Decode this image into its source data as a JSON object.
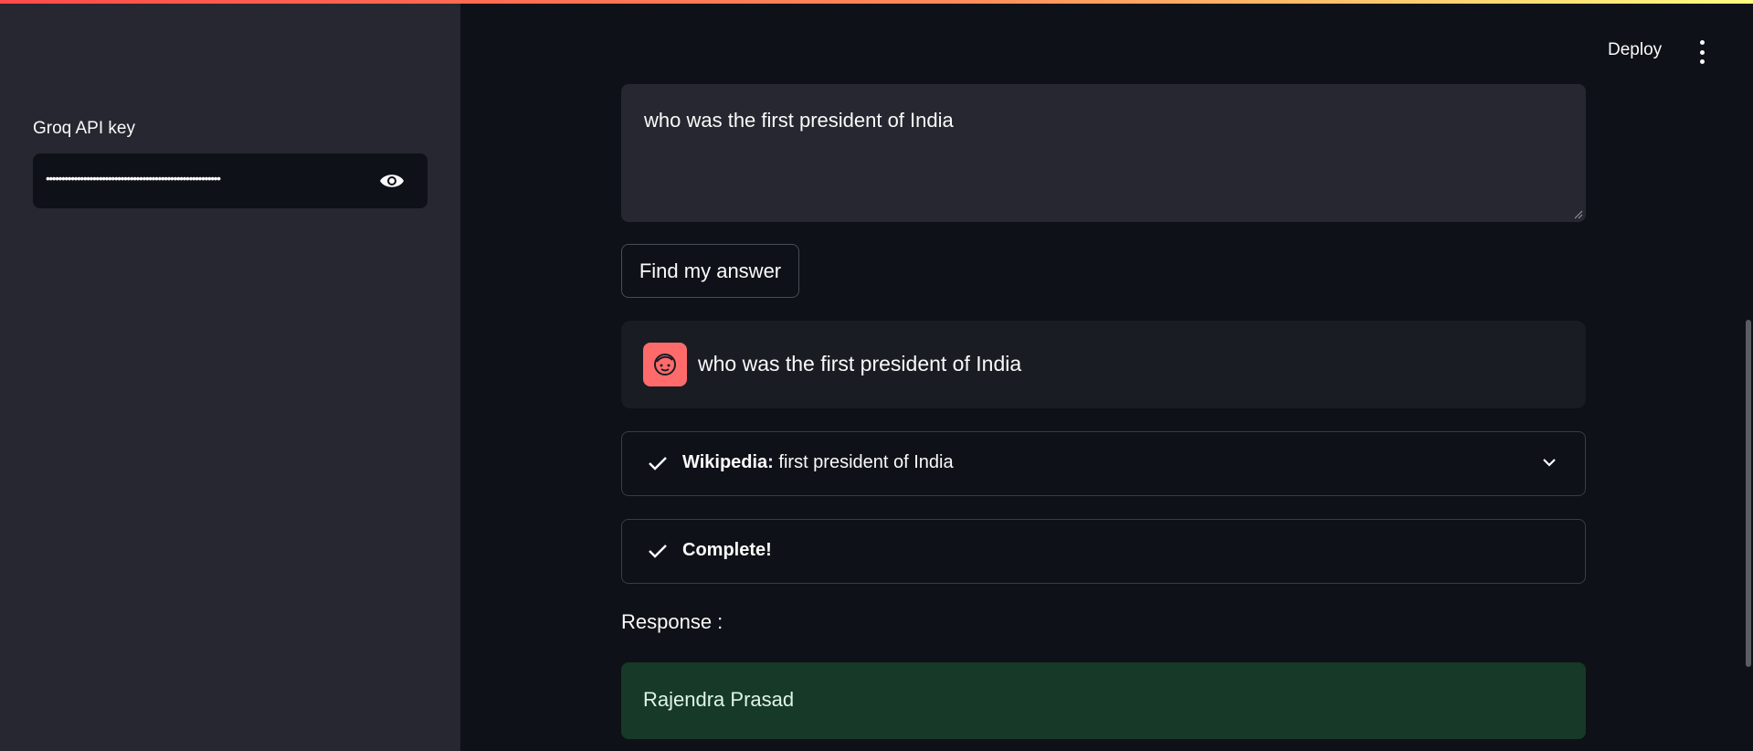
{
  "colors": {
    "background": "#0e1117",
    "sidebar": "#262730",
    "avatar": "#ff6b6b",
    "success_bg": "#173928"
  },
  "header": {
    "deploy_label": "Deploy",
    "menu_icon": "more-vertical-icon"
  },
  "sidebar": {
    "api_key_label": "Groq API key",
    "api_key_masked": "••••••••••••••••••••••••••••••••••••••••••••••••••••••••",
    "toggle_icon": "eye-icon"
  },
  "main": {
    "question": "who was the first president of India",
    "submit_label": "Find my answer",
    "chat": {
      "avatar_icon": "user-face-icon",
      "text": "who was the first president of India"
    },
    "steps": [
      {
        "title": "Wikipedia:",
        "detail": "first president of India",
        "icon": "check-icon",
        "expand_icon": "chevron-down-icon"
      },
      {
        "title": "Complete!",
        "detail": "",
        "icon": "check-icon"
      }
    ],
    "response_label": "Response :",
    "response_text": "Rajendra Prasad"
  }
}
